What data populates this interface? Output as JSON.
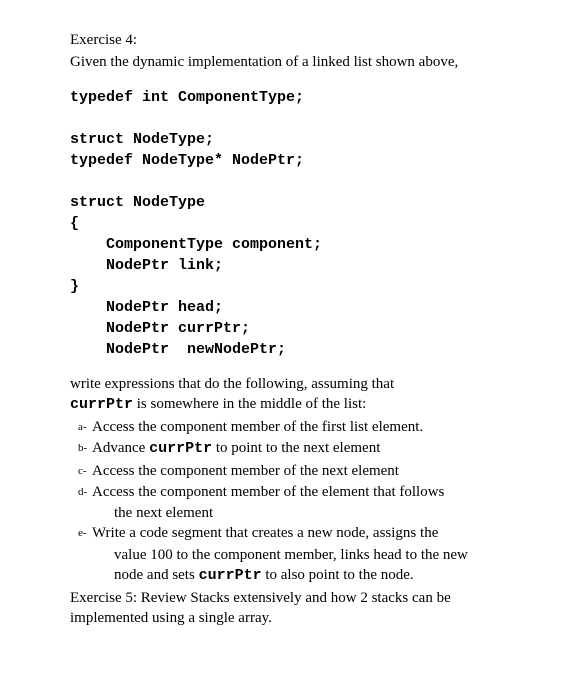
{
  "exercise4": {
    "title": "Exercise 4:",
    "intro": "Given the dynamic implementation of a linked list shown above,",
    "code": {
      "l1": "typedef int ComponentType;",
      "l2": "struct NodeType;",
      "l3": "typedef NodeType* NodePtr;",
      "l4": "struct NodeType",
      "l5": "{",
      "l6": "    ComponentType component;",
      "l7": "    NodePtr link;",
      "l8": "}",
      "l9": "    NodePtr head;",
      "l10": "    NodePtr currPtr;",
      "l11": "    NodePtr  newNodePtr;"
    },
    "instruction_pre": "write expressions that do the following, assuming that ",
    "instruction_code": "currPtr",
    "instruction_post": " is somewhere in the middle of the list:",
    "items": {
      "a": {
        "marker": "a-",
        "text": "Access the component member of the first list element."
      },
      "b": {
        "marker": "b-",
        "pre": "Advance ",
        "code": "currPtr",
        "post": " to point to the next element"
      },
      "c": {
        "marker": "c-",
        "text": "Access the component member of the next element"
      },
      "d": {
        "marker": "d-",
        "line1": "Access the component member of the element that follows",
        "line2": "the next element"
      },
      "e": {
        "marker": "e-",
        "line1": "Write a code segment that creates a new node, assigns the",
        "line2": "value 100 to the component member, links head to the new",
        "line3_pre": "node and sets ",
        "line3_code": "currPtr",
        "line3_post": " to also point to the node."
      }
    }
  },
  "exercise5": {
    "line1": "Exercise 5: Review Stacks extensively and how 2 stacks can be",
    "line2": "implemented using a single array."
  }
}
